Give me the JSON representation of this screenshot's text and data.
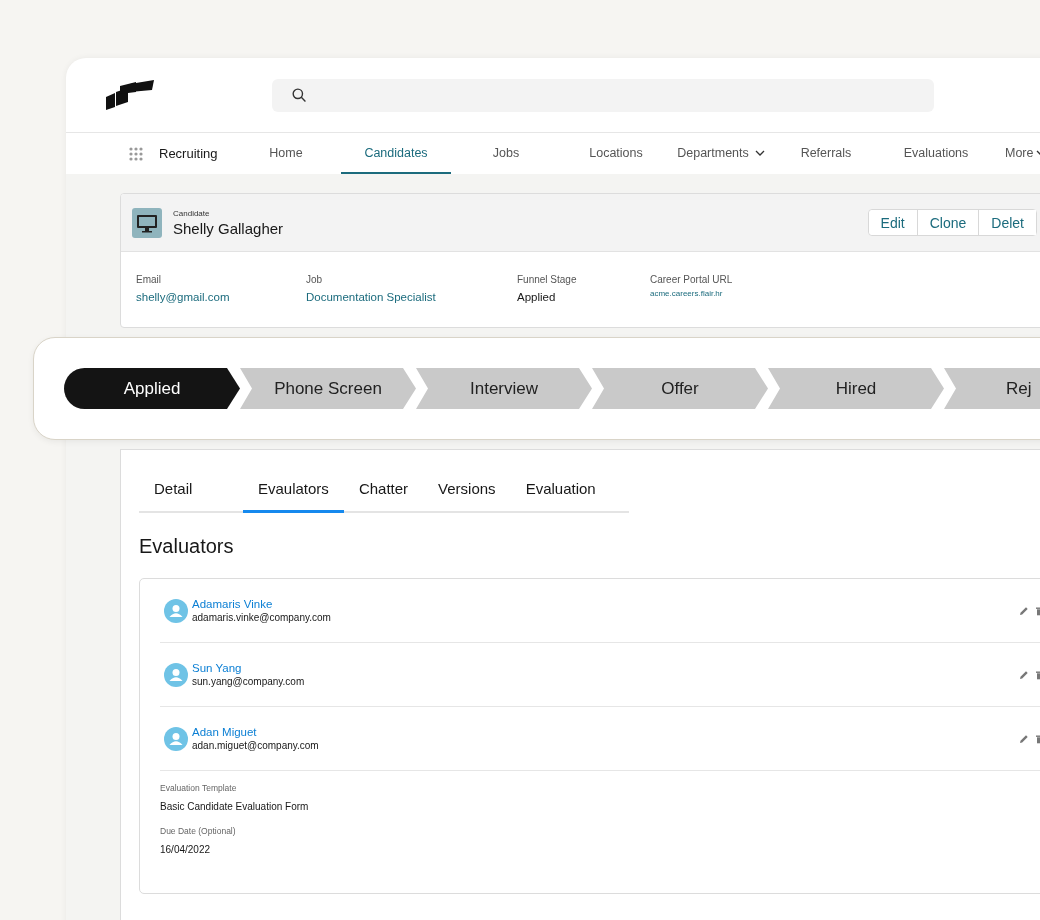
{
  "nav": {
    "app_name": "Recruiting",
    "tabs": [
      {
        "label": "Home",
        "selected": false,
        "menu": false
      },
      {
        "label": "Candidates",
        "selected": true,
        "menu": false
      },
      {
        "label": "Jobs",
        "selected": false,
        "menu": false
      },
      {
        "label": "Locations",
        "selected": false,
        "menu": false
      },
      {
        "label": "Departments",
        "selected": false,
        "menu": true
      },
      {
        "label": "Referrals",
        "selected": false,
        "menu": false
      },
      {
        "label": "Evaluations",
        "selected": false,
        "menu": false
      },
      {
        "label": "More",
        "selected": false,
        "menu": true
      }
    ]
  },
  "record": {
    "type": "Candidate",
    "name": "Shelly Gallagher",
    "actions": [
      "Edit",
      "Clone",
      "Delet"
    ],
    "fields": [
      {
        "label": "Email",
        "value": "shelly@gmail.com",
        "kind": "link"
      },
      {
        "label": "Job",
        "value": "Documentation Specialist",
        "kind": "link"
      },
      {
        "label": "Funnel Stage",
        "value": "Applied",
        "kind": "text"
      },
      {
        "label": "Career Portal URL",
        "value": "acme.careers.flair.hr",
        "kind": "small-link"
      }
    ]
  },
  "stages": [
    {
      "label": "Applied",
      "selected": true
    },
    {
      "label": "Phone Screen",
      "selected": false
    },
    {
      "label": "Interview",
      "selected": false
    },
    {
      "label": "Offer",
      "selected": false
    },
    {
      "label": "Hired",
      "selected": false
    },
    {
      "label": "Rej",
      "selected": false
    }
  ],
  "tabs": [
    {
      "label": "Detail",
      "selected": false
    },
    {
      "label": "Evaulators",
      "selected": true
    },
    {
      "label": "Chatter",
      "selected": false
    },
    {
      "label": "Versions",
      "selected": false
    },
    {
      "label": "Evaluation",
      "selected": false
    }
  ],
  "section_title": "Evaluators",
  "evaluators": [
    {
      "name": "Adamaris Vinke",
      "email": "adamaris.vinke@company.com"
    },
    {
      "name": "Sun Yang",
      "email": "sun.yang@company.com"
    },
    {
      "name": "Adan Miguet",
      "email": "adan.miguet@company.com"
    }
  ],
  "details": [
    {
      "label": "Evaluation Template",
      "value": "Basic Candidate Evaluation Form"
    },
    {
      "label": "Due Date (Optional)",
      "value": "16/04/2022"
    }
  ]
}
